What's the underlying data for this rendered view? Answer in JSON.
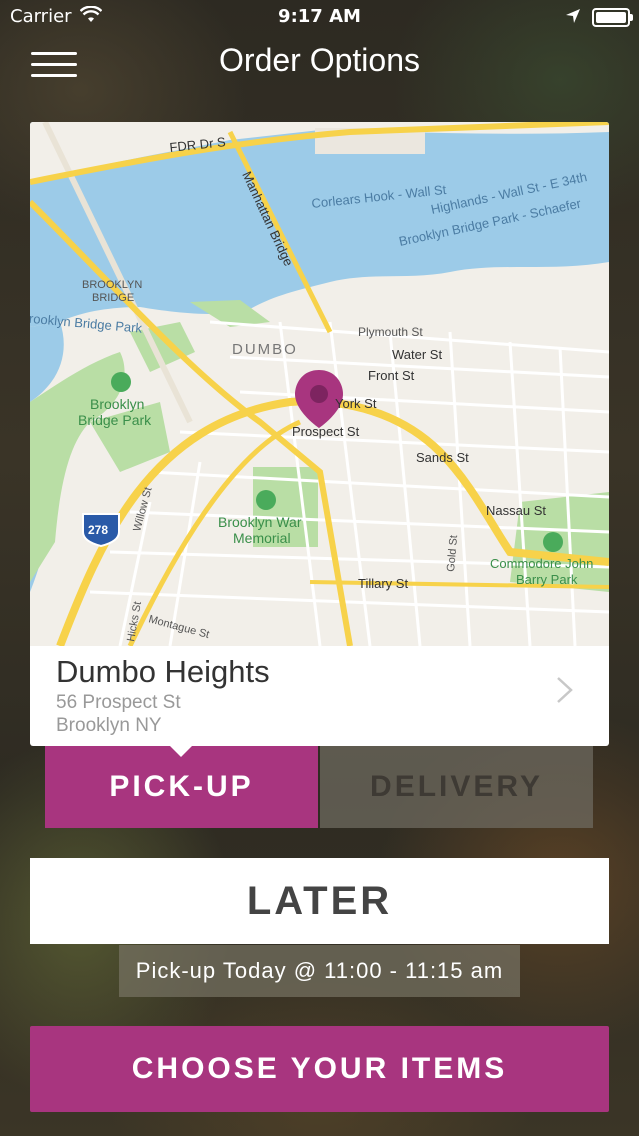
{
  "status_bar": {
    "carrier": "Carrier",
    "time": "9:17 AM"
  },
  "header": {
    "title": "Order Options"
  },
  "location": {
    "name": "Dumbo Heights",
    "address_line1": "56 Prospect St",
    "address_line2": "Brooklyn NY"
  },
  "map": {
    "labels": {
      "fdr": "FDR Dr S",
      "manhattan_bridge": "Manhattan Bridge",
      "corlears": "Corlears Hook - Wall St",
      "highlands": "Highlands - Wall St - E 34th",
      "bbp_schaefer": "Brooklyn Bridge Park - Schaefer",
      "brooklyn_bridge_1": "BROOKLYN",
      "brooklyn_bridge_2": "BRIDGE",
      "bbp_water": "Brooklyn Bridge Park",
      "dumbo": "DUMBO",
      "plymouth": "Plymouth St",
      "water_st": "Water St",
      "front_st": "Front St",
      "york_st": "York St",
      "prospect_st": "Prospect St",
      "bbp_park_1": "Brooklyn",
      "bbp_park_2": "Bridge Park",
      "sands_st": "Sands St",
      "nassau_st": "Nassau St",
      "willow_st": "Willow St",
      "war_memorial_1": "Brooklyn War",
      "war_memorial_2": "Memorial",
      "gold_st": "Gold St",
      "commodore_1": "Commodore John",
      "commodore_2": "Barry Park",
      "tillary_st": "Tillary St",
      "hicks_st": "Hicks St",
      "montague_st": "Montague St",
      "highway": "278"
    },
    "colors": {
      "water": "#9ccbe8",
      "land": "#f2efe9",
      "park": "#b9dea5",
      "highway": "#f7d24a",
      "pin": "#a8357f"
    }
  },
  "tabs": {
    "pickup": "PICK-UP",
    "delivery": "DELIVERY",
    "selected": "PICK-UP"
  },
  "timing": {
    "mode": "LATER",
    "pickup_text": "Pick-up Today @ 11:00 - 11:15 am"
  },
  "cta": {
    "label": "CHOOSE YOUR ITEMS"
  },
  "colors": {
    "accent": "#a8357f"
  }
}
